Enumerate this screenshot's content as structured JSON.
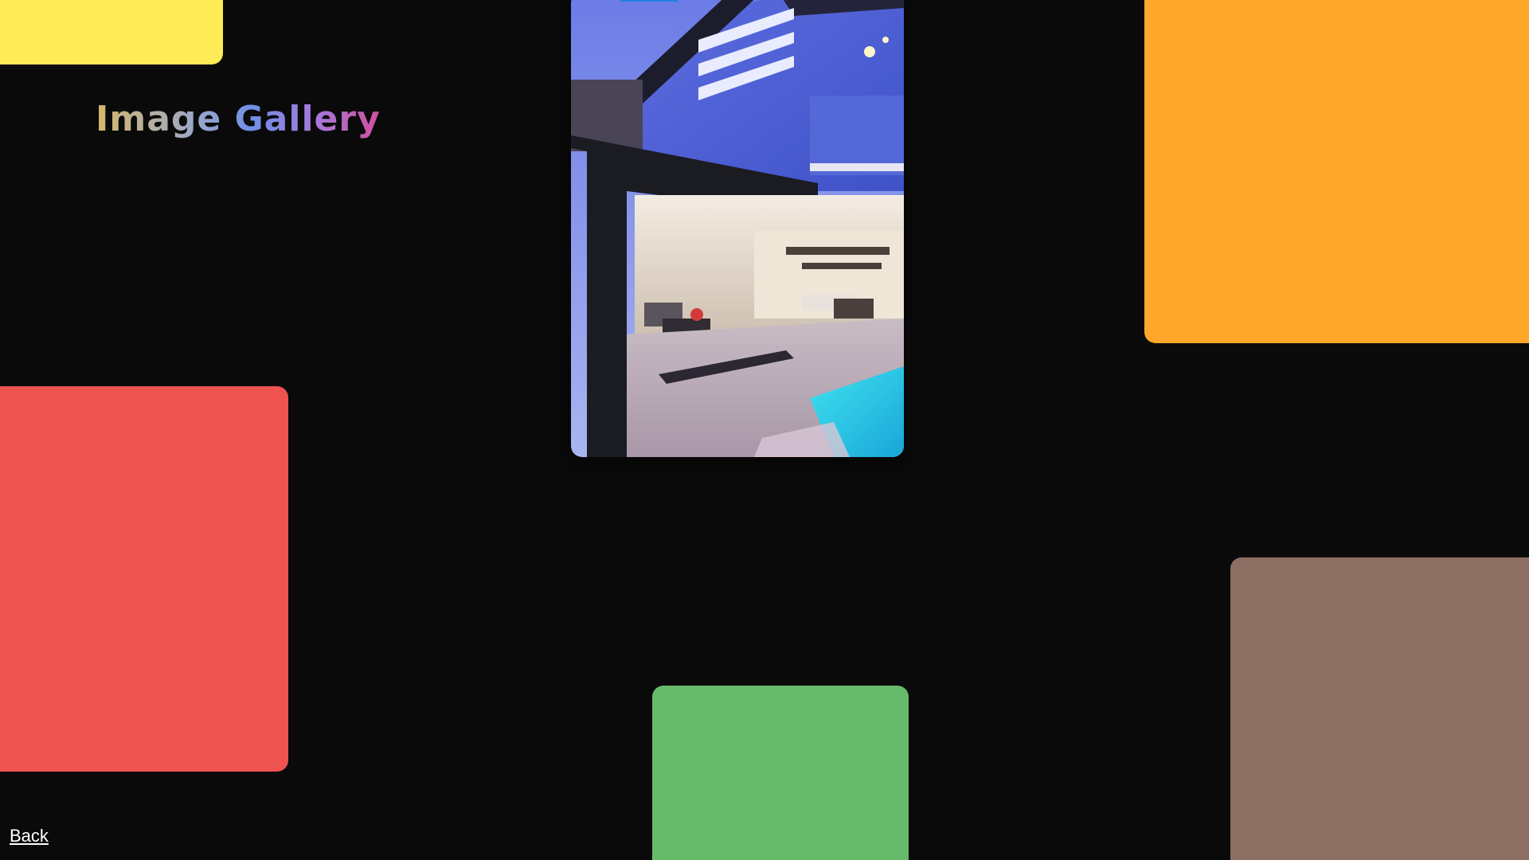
{
  "page": {
    "title": "Image Gallery",
    "background_color": "#0a0a0b"
  },
  "tiles": [
    {
      "name": "yellow-tile",
      "color": "#ffeb55"
    },
    {
      "name": "orange-tile",
      "color": "#ffa72a"
    },
    {
      "name": "red-tile",
      "color": "#ef5350"
    },
    {
      "name": "green-tile",
      "color": "#66bb6a"
    },
    {
      "name": "brown-tile",
      "color": "#8d6e63"
    }
  ],
  "photo": {
    "subject": "modern-house-with-pool-at-dusk"
  },
  "nav": {
    "back_label": "Back"
  }
}
